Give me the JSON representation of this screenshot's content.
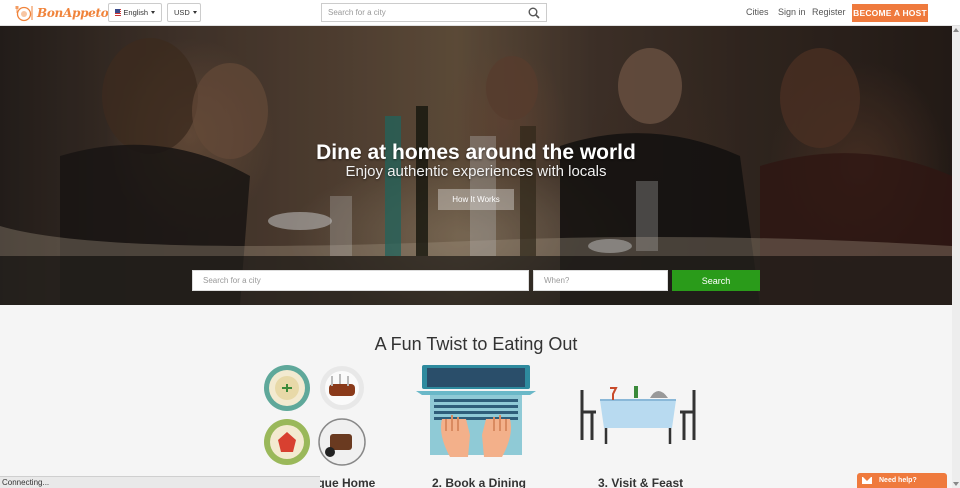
{
  "header": {
    "logo_text": "BonAppetour",
    "language": "English",
    "currency": "USD",
    "search_placeholder": "Search for a city",
    "nav": {
      "cities": "Cities",
      "signin": "Sign in",
      "register": "Register"
    },
    "host_button": "BECOME A HOST"
  },
  "hero": {
    "title": "Dine at homes around the world",
    "subtitle": "Enjoy authentic experiences with locals",
    "how_button": "How It Works",
    "city_placeholder": "Search for a city",
    "when_placeholder": "When?",
    "search_button": "Search"
  },
  "section": {
    "title": "A Fun Twist to Eating Out",
    "steps": [
      "ique Home",
      "2. Book a Dining",
      "3. Visit & Feast"
    ]
  },
  "status_text": "Connecting...",
  "help_label": "Need help?",
  "colors": {
    "brand": "#ef7a3d",
    "search_green": "#2a9b1a"
  }
}
